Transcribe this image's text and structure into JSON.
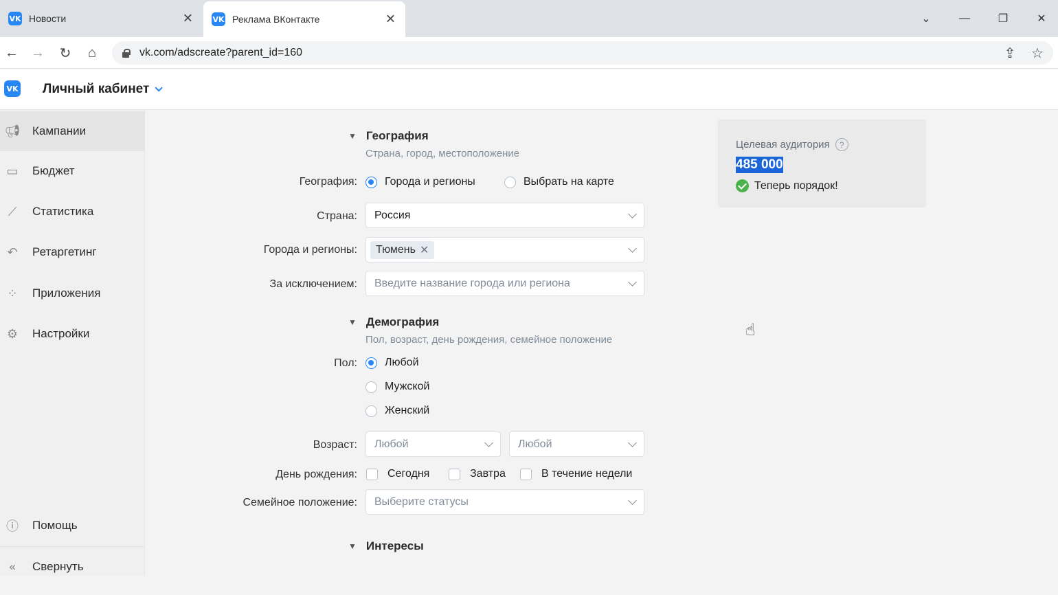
{
  "browser": {
    "tabs": [
      {
        "title": "Новости",
        "favicon": "vk-icon"
      },
      {
        "title": "Реклама ВКонтакте",
        "favicon": "vk-icon"
      }
    ],
    "url": "vk.com/adscreate?parent_id=160"
  },
  "header": {
    "logo": "VK",
    "title": "Личный кабинет"
  },
  "sidebar": {
    "items": [
      {
        "label": "Кампании",
        "icon": "megaphone-icon",
        "active": true
      },
      {
        "label": "Бюджет",
        "icon": "wallet-icon"
      },
      {
        "label": "Статистика",
        "icon": "chart-icon"
      },
      {
        "label": "Ретаргетинг",
        "icon": "retarget-icon"
      },
      {
        "label": "Приложения",
        "icon": "apps-icon"
      },
      {
        "label": "Настройки",
        "icon": "gear-icon"
      }
    ],
    "bottom": [
      {
        "label": "Помощь",
        "icon": "help-icon"
      },
      {
        "label": "Свернуть",
        "icon": "collapse-icon"
      }
    ]
  },
  "geography": {
    "title": "География",
    "subtitle": "Страна, город, местоположение",
    "mode_label": "География:",
    "mode_options": [
      "Города и регионы",
      "Выбрать на карте"
    ],
    "mode_selected": 0,
    "country_label": "Страна:",
    "country_value": "Россия",
    "cities_label": "Города и регионы:",
    "cities_tag": "Тюмень",
    "exclude_label": "За исключением:",
    "exclude_placeholder": "Введите название города или региона"
  },
  "demography": {
    "title": "Демография",
    "subtitle": "Пол, возраст, день рождения, семейное положение",
    "gender_label": "Пол:",
    "gender_options": [
      "Любой",
      "Мужской",
      "Женский"
    ],
    "gender_selected": 0,
    "age_label": "Возраст:",
    "age_from": "Любой",
    "age_to": "Любой",
    "birthday_label": "День рождения:",
    "birthday_options": [
      "Сегодня",
      "Завтра",
      "В течение недели"
    ],
    "family_label": "Семейное положение:",
    "family_placeholder": "Выберите статусы"
  },
  "interests": {
    "title": "Интересы"
  },
  "audience": {
    "title": "Целевая аудитория",
    "help": "?",
    "count": "485 000",
    "status": "Теперь порядок!"
  },
  "colors": {
    "accent": "#2787f5",
    "success": "#4bb34b",
    "selection": "#1a66d9"
  }
}
